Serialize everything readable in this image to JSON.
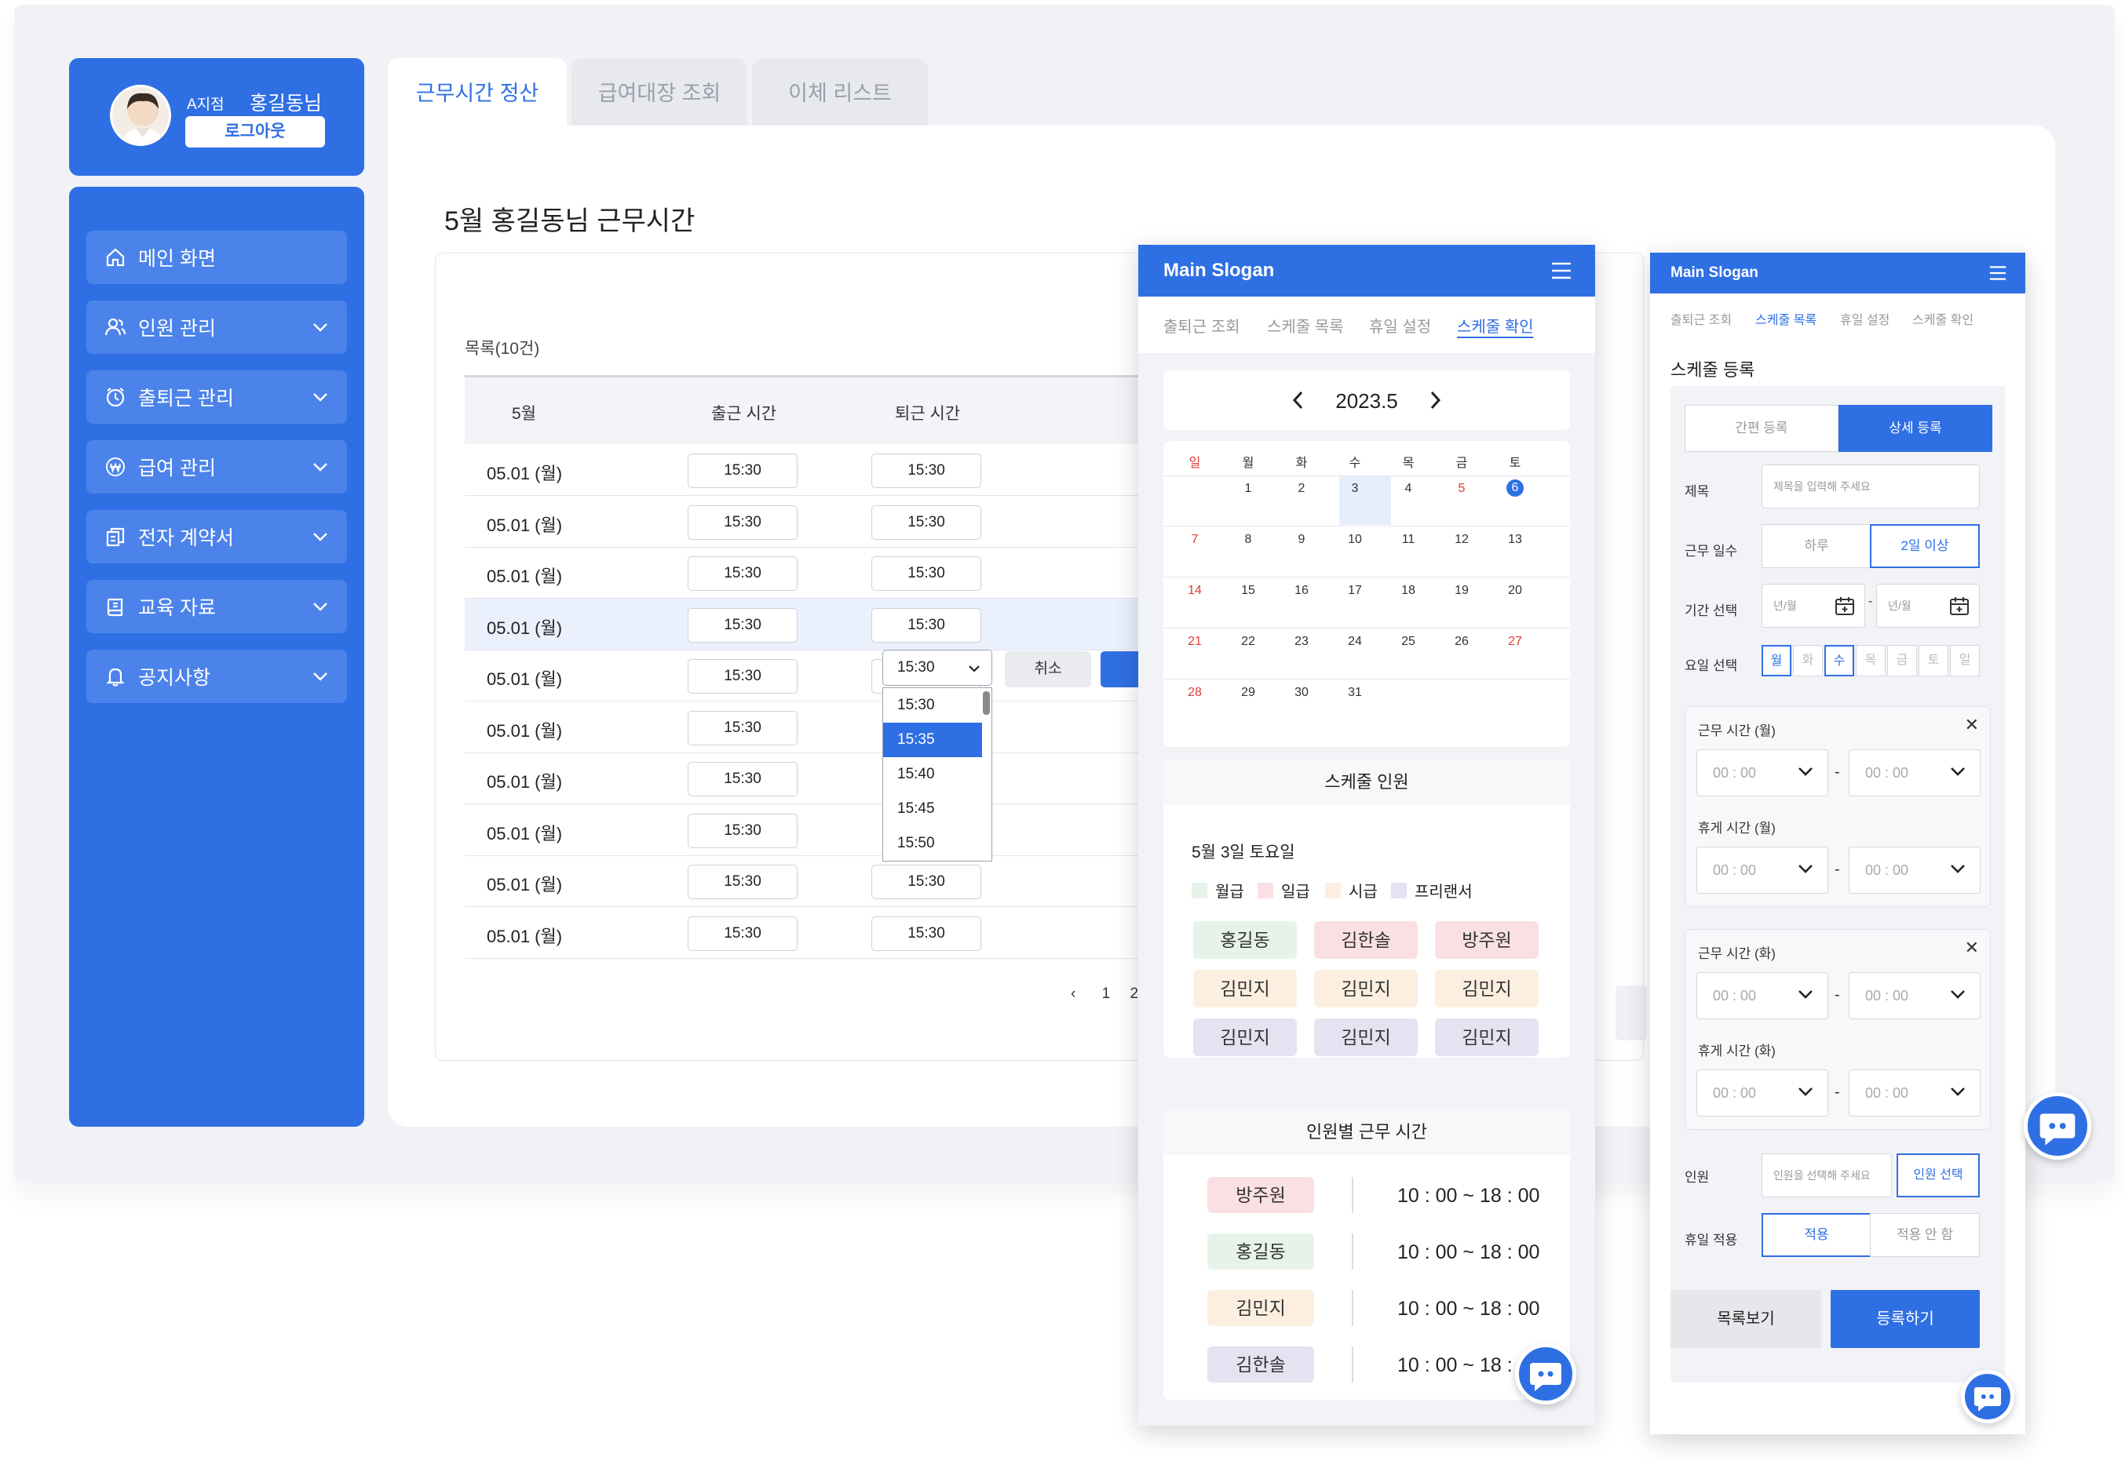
{
  "profile": {
    "branch": "A지점",
    "name": "홍길동님",
    "logout": "로그아웃"
  },
  "sidebar": {
    "items": [
      {
        "label": "메인 화면",
        "icon": "home-icon"
      },
      {
        "label": "인원 관리",
        "icon": "users-icon"
      },
      {
        "label": "출퇴근 관리",
        "icon": "clock-icon"
      },
      {
        "label": "급여 관리",
        "icon": "won-icon"
      },
      {
        "label": "전자 계약서",
        "icon": "document-icon"
      },
      {
        "label": "교육 자료",
        "icon": "book-icon"
      },
      {
        "label": "공지사항",
        "icon": "bell-icon"
      }
    ]
  },
  "tabs": [
    "근무시간 정산",
    "급여대장 조회",
    "이체 리스트"
  ],
  "main": {
    "title": "5월 홍길동님 근무시간",
    "list_count": "목록(10건)",
    "columns": [
      "5월",
      "출근 시간",
      "퇴근 시간"
    ],
    "rows": [
      {
        "date": "05.01 (월)",
        "in": "15:30",
        "out": "15:30"
      },
      {
        "date": "05.01 (월)",
        "in": "15:30",
        "out": "15:30"
      },
      {
        "date": "05.01 (월)",
        "in": "15:30",
        "out": "15:30"
      },
      {
        "date": "05.01 (월)",
        "in": "15:30",
        "out": "15:30"
      },
      {
        "date": "05.01 (월)",
        "in": "15:30",
        "out": "15:30"
      },
      {
        "date": "05.01 (월)",
        "in": "15:30",
        "out": ""
      },
      {
        "date": "05.01 (월)",
        "in": "15:30",
        "out": ""
      },
      {
        "date": "05.01 (월)",
        "in": "15:30",
        "out": ""
      },
      {
        "date": "05.01 (월)",
        "in": "15:30",
        "out": "15:30"
      },
      {
        "date": "05.01 (월)",
        "in": "15:30",
        "out": "15:30"
      }
    ],
    "select_value": "15:30",
    "cancel": "취소",
    "dropdown_options": [
      "15:30",
      "15:35",
      "15:40",
      "15:45",
      "15:50"
    ],
    "dropdown_selected": "15:35",
    "pager": [
      "1",
      "2"
    ]
  },
  "mobile1": {
    "slogan": "Main Slogan",
    "tabs": [
      "출퇴근 조회",
      "스케줄 목록",
      "휴일 설정",
      "스케줄 확인"
    ],
    "month": "2023.5",
    "weekdays": [
      "일",
      "월",
      "화",
      "수",
      "목",
      "금",
      "토"
    ],
    "weeks": [
      [
        "",
        "1",
        "2",
        "3",
        "4",
        "5",
        "6"
      ],
      [
        "7",
        "8",
        "9",
        "10",
        "11",
        "12",
        "13"
      ],
      [
        "14",
        "15",
        "16",
        "17",
        "18",
        "19",
        "20"
      ],
      [
        "21",
        "22",
        "23",
        "24",
        "25",
        "26",
        "27"
      ],
      [
        "28",
        "29",
        "30",
        "31",
        "",
        "",
        ""
      ]
    ],
    "schedule_title": "스케줄 인원",
    "schedule_date": "5월 3일 토요일",
    "legend": [
      {
        "label": "월급",
        "color": "#e7f3e8"
      },
      {
        "label": "일급",
        "color": "#fbe0e3"
      },
      {
        "label": "시급",
        "color": "#fcefe0"
      },
      {
        "label": "프리랜서",
        "color": "#e4e3f1"
      }
    ],
    "staff": [
      [
        "홍길동",
        "김한솔",
        "방주원"
      ],
      [
        "김민지",
        "김민지",
        "김민지"
      ],
      [
        "김민지",
        "김민지",
        "김민지"
      ]
    ],
    "worktime_title": "인원별 근무 시간",
    "worktimes": [
      {
        "name": "방주원",
        "time": "10 : 00 ~ 18 : 00"
      },
      {
        "name": "홍길동",
        "time": "10 : 00 ~ 18 : 00"
      },
      {
        "name": "김민지",
        "time": "10 : 00 ~ 18 : 00"
      },
      {
        "name": "김한솔",
        "time": "10 : 00 ~ 18 : 00"
      }
    ]
  },
  "mobile2": {
    "slogan": "Main Slogan",
    "tabs": [
      "출퇴근 조회",
      "스케줄 목록",
      "휴일 설정",
      "스케줄 확인"
    ],
    "title": "스케줄 등록",
    "reg_modes": [
      "간편 등록",
      "상세 등록"
    ],
    "f_title": "제목",
    "f_title_ph": "제목을 입력해 주세요",
    "f_days": "근무 일수",
    "days_opts": [
      "하루",
      "2일 이상"
    ],
    "f_period": "기간 선택",
    "period_ph": "년/월",
    "f_weekday": "요일 선택",
    "weekdays": [
      "월",
      "화",
      "수",
      "목",
      "금",
      "토",
      "일"
    ],
    "work_mon": "근무 시간 (월)",
    "break_mon": "휴게 시간 (월)",
    "work_tue": "근무 시간 (화)",
    "break_tue": "휴게 시간 (화)",
    "time_ph": "00 : 00",
    "f_staff": "인원",
    "staff_ph": "인원을 선택해 주세요",
    "staff_btn": "인원 선택",
    "f_holiday": "휴일 적용",
    "holiday_opts": [
      "적용",
      "적용 안 함"
    ],
    "list_btn": "목록보기",
    "submit_btn": "등록하기"
  },
  "colors": {
    "primary": "#2f6fe4",
    "sunday": "#e53935"
  }
}
